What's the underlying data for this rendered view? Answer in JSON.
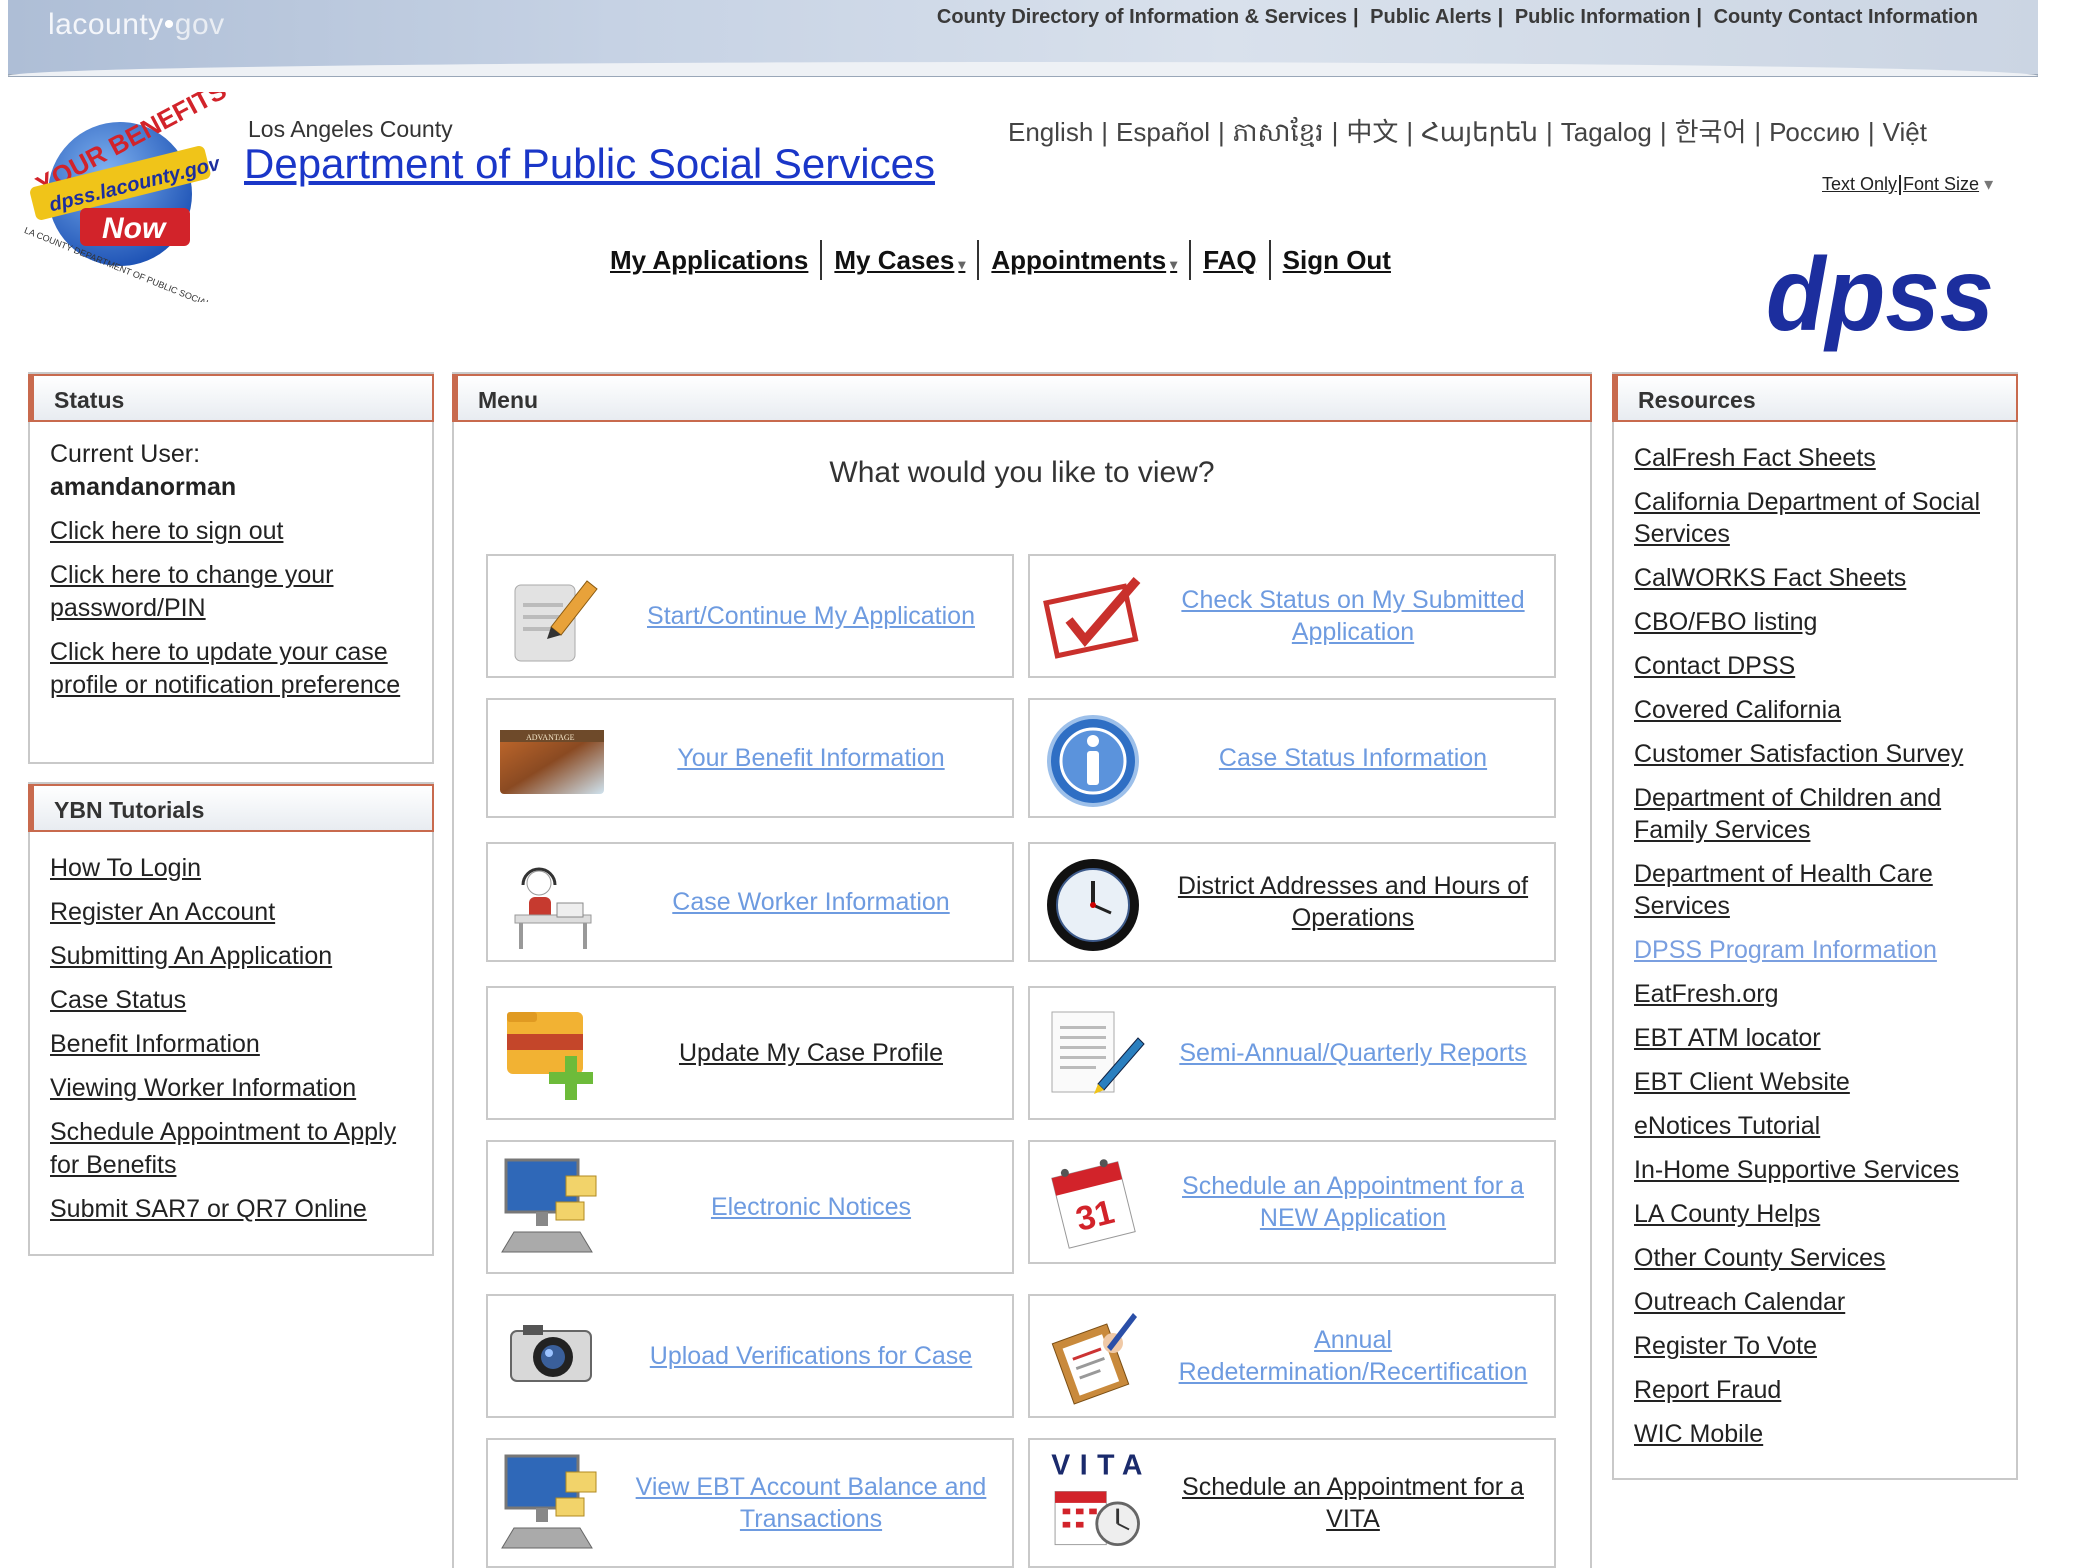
{
  "topbar": {
    "logo": {
      "la": "lacounty",
      "dot": "•",
      "gov": "gov"
    },
    "links": [
      "County Directory of Information & Services",
      "Public Alerts",
      "Public Information",
      "County Contact Information"
    ]
  },
  "header": {
    "la_county": "Los Angeles County",
    "dept_title": "Department of Public Social Services",
    "logo": {
      "top": "YOUR BENEFITS",
      "url": "dpss.lacounty.gov",
      "now": "Now",
      "bottom": "LA COUNTY DEPARTMENT OF PUBLIC SOCIAL SERVICES"
    },
    "dpss_logo": "dpss"
  },
  "languages": [
    "English",
    "Español",
    "ភាសាខ្មែរ",
    "中文",
    "Հայերեն",
    "Tagalog",
    "한국어",
    "Россию",
    "Việt"
  ],
  "accessibility": {
    "text_only": "Text Only",
    "font_size": "Font Size",
    "caret": "▾"
  },
  "nav": {
    "items": [
      {
        "label": "My Applications",
        "caret": ""
      },
      {
        "label": "My Cases",
        "caret": "▾"
      },
      {
        "label": "Appointments",
        "caret": "▾"
      },
      {
        "label": "FAQ",
        "caret": ""
      },
      {
        "label": "Sign Out",
        "caret": ""
      }
    ]
  },
  "status": {
    "title": "Status",
    "current_user_label": "Current User:",
    "username": "amandanorman",
    "links": [
      "Click here to sign out",
      "Click here to change your password/PIN",
      "Click here to update your case profile or notification preference"
    ]
  },
  "tutorials": {
    "title": "YBN Tutorials",
    "links": [
      "How To Login",
      "Register An Account",
      "Submitting An Application",
      "Case Status",
      "Benefit Information",
      "Viewing Worker Information",
      "Schedule Appointment to Apply for Benefits",
      "Submit SAR7 or QR7 Online"
    ]
  },
  "menu": {
    "title": "Menu",
    "question": "What would you like to view?",
    "tiles": [
      {
        "label": "Start/Continue My Application",
        "icon": "pencil-document-icon"
      },
      {
        "label": "Check Status on My Submitted Application",
        "icon": "checkmark-icon"
      },
      {
        "label": "Your Benefit Information",
        "icon": "advantage-card-icon",
        "card_text": "ADVANTAGE"
      },
      {
        "label": "Case Status Information",
        "icon": "info-icon"
      },
      {
        "label": "Case Worker Information",
        "icon": "case-worker-icon"
      },
      {
        "label": "District Addresses and Hours of Operations",
        "icon": "clock-icon"
      },
      {
        "label": "Update My Case Profile",
        "icon": "folder-add-icon"
      },
      {
        "label": "Semi-Annual/Quarterly Reports",
        "icon": "report-pen-icon"
      },
      {
        "label": "Electronic Notices",
        "icon": "computer-mail-icon"
      },
      {
        "label": "Schedule an Appointment for a NEW Application",
        "icon": "calendar-icon",
        "calendar_day": "31"
      },
      {
        "label": "Upload Verifications for Case",
        "icon": "camera-icon"
      },
      {
        "label": "Annual Redetermination/Recertification",
        "icon": "clipboard-sign-icon"
      },
      {
        "label": "View EBT Account Balance and Transactions",
        "icon": "computer-mail-icon"
      },
      {
        "label": "Schedule an Appointment for a VITA",
        "icon": "vita-calendar-icon",
        "vita_text": "VITA"
      }
    ]
  },
  "resources": {
    "title": "Resources",
    "links": [
      "CalFresh Fact Sheets",
      "California Department of Social Services",
      "CalWORKS Fact Sheets",
      "CBO/FBO listing",
      "Contact DPSS",
      "Covered California",
      "Customer Satisfaction Survey",
      "Department of Children and Family Services",
      "Department of Health Care Services",
      "DPSS Program Information",
      "EatFresh.org",
      "EBT ATM locator",
      "EBT Client Website",
      "eNotices Tutorial",
      "In-Home Supportive Services",
      "LA County Helps",
      "Other County Services",
      "Outreach Calendar",
      "Register To Vote",
      "Report Fraud",
      "WIC Mobile"
    ]
  },
  "colors": {
    "accent": "#c86a4e",
    "title_blue": "#1a36c8",
    "link_light": "#6e9be0",
    "dpss_blue": "#1c2e9e"
  }
}
